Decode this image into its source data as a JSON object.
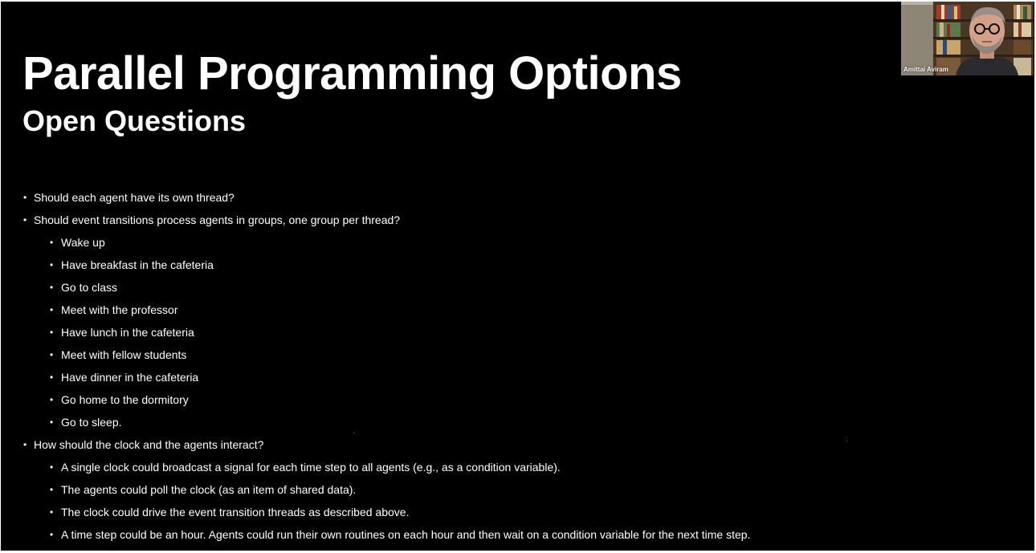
{
  "slide": {
    "title": "Parallel Programming Options",
    "subtitle": "Open Questions",
    "bullet_glyph": "•",
    "bullets": [
      {
        "level": 1,
        "text": "Should each agent have its own thread?"
      },
      {
        "level": 1,
        "text": "Should event transitions process agents in groups, one group per thread?"
      },
      {
        "level": 2,
        "text": "Wake up"
      },
      {
        "level": 2,
        "text": "Have breakfast in the cafeteria"
      },
      {
        "level": 2,
        "text": "Go to class"
      },
      {
        "level": 2,
        "text": "Meet with the professor"
      },
      {
        "level": 2,
        "text": "Have lunch in the cafeteria"
      },
      {
        "level": 2,
        "text": "Meet with fellow students"
      },
      {
        "level": 2,
        "text": "Have dinner in the cafeteria"
      },
      {
        "level": 2,
        "text": "Go home to the dormitory"
      },
      {
        "level": 2,
        "text": "Go to sleep."
      },
      {
        "level": 1,
        "text": "How should the clock and the agents interact?"
      },
      {
        "level": 2,
        "text": "A single clock could broadcast a signal for each time step to all agents (e.g., as a condition variable)."
      },
      {
        "level": 2,
        "text": "The agents could poll the clock (as an item of shared data)."
      },
      {
        "level": 2,
        "text": "The clock could drive the event transition threads as described above."
      },
      {
        "level": 2,
        "text": "A time step could be an hour. Agents could run their own routines on each hour and then wait on a condition variable for the next time step."
      }
    ]
  },
  "video_tile": {
    "participant_name": "Amittai Aviram"
  },
  "colors": {
    "slide_background": "#000000",
    "slide_text": "#ffffff",
    "window_frame": "#ffffff"
  }
}
